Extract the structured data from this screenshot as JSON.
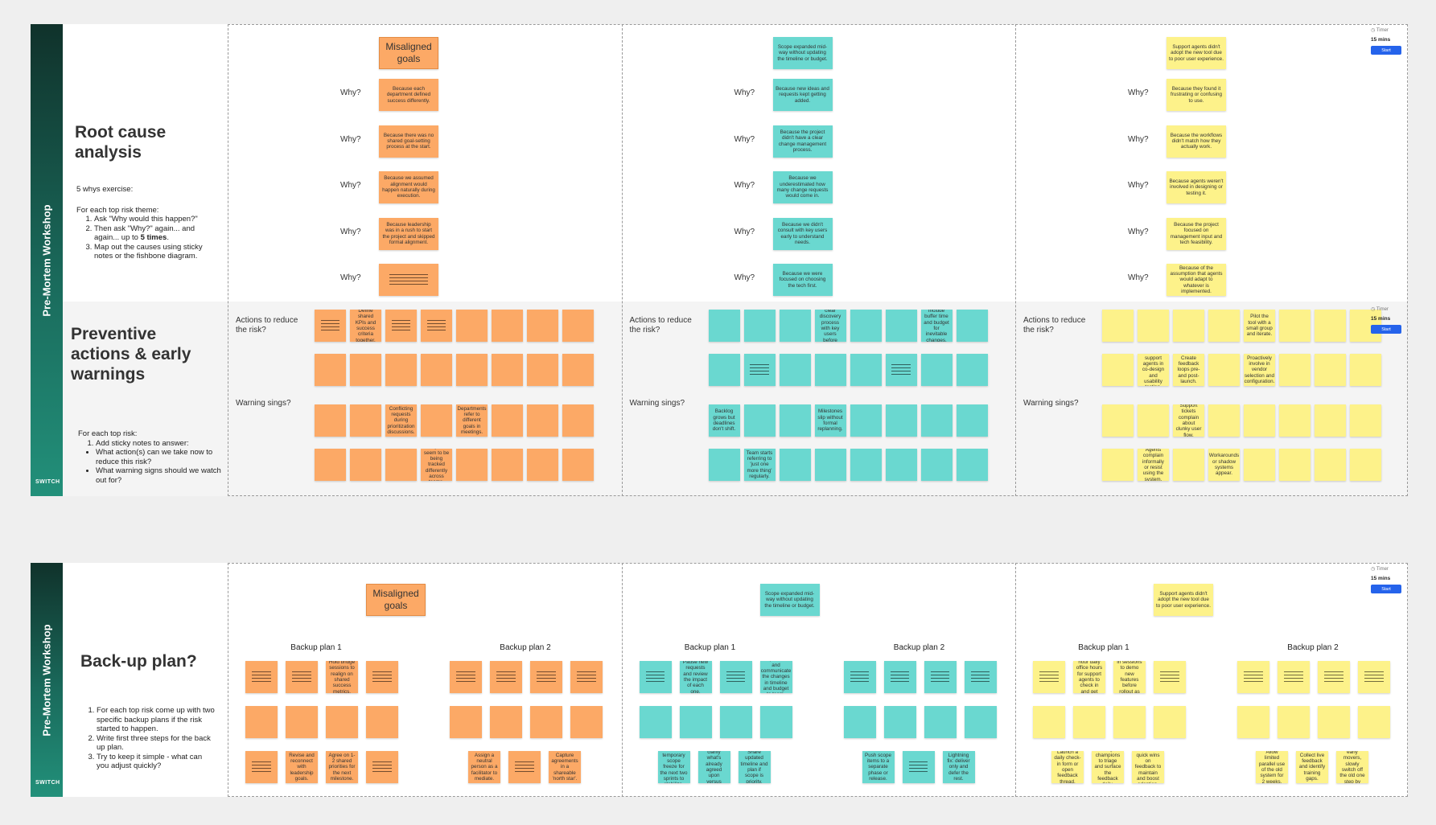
{
  "boards": [
    {
      "workshop_title": "Pre-Mortem Workshop",
      "logo": "SWITCH",
      "section1": {
        "title": "Root cause analysis",
        "exercise": "5 whys exercise:",
        "intro": "For each top risk theme:",
        "steps": [
          "Ask \"Why would this happen?\"",
          "Then ask \"Why?\" again... and again... up to 5 times.",
          "Map out the causes using sticky notes or the fishbone diagram."
        ]
      },
      "section2": {
        "title": "Preventive actions & early warnings",
        "intro": "For each top risk:",
        "step": "Add sticky notes to answer:",
        "bullets": [
          "What action(s) can we take now to reduce this risk?",
          "What warning signs should we watch out for?"
        ]
      },
      "why_label": "Why?",
      "actions_label": "Actions to reduce the risk?",
      "warning_label": "Warning sings?",
      "timer": {
        "label": "Timer",
        "time": "15 mins",
        "button": "Start"
      },
      "columns": [
        {
          "color": "orange",
          "top_note": "Misaligned goals",
          "whys": [
            "Because each department defined success differently.",
            "Because there was no shared goal-setting process at the start.",
            "Because we assumed alignment would happen naturally during execution.",
            "Because leadership was in a rush to start the project and skipped formal alignment.",
            ""
          ],
          "actions": [
            [
              "",
              "Define shared KPIs and success criteria together.",
              "",
              "",
              "",
              "",
              "",
              ""
            ],
            [
              "",
              "",
              "",
              "",
              "",
              "",
              "",
              ""
            ]
          ],
          "warnings": [
            [
              "",
              "",
              "Conflicting requests during prioritization discussions.",
              "",
              "Departments refer to different goals in meetings.",
              "",
              "",
              ""
            ],
            [
              "",
              "",
              "",
              "Projects seem to be being tracked differently across teams.",
              "",
              "",
              "",
              ""
            ]
          ]
        },
        {
          "color": "teal",
          "top_note": "Scope expanded mid-way without updating the timeline or budget.",
          "whys": [
            "Because new ideas and requests kept getting added.",
            "Because the project didn't have a clear change management process.",
            "Because we underestimated how many change requests would come in.",
            "Because we didn't consult with key users early to understand needs.",
            "Because we were focused on choosing the tech first."
          ],
          "actions": [
            [
              "",
              "",
              "",
              "Create a clear discovery process with key users before scoping.",
              "",
              "",
              "Include buffer time and budget for inevitable changes.",
              ""
            ],
            [
              "",
              "",
              "",
              "",
              "",
              "",
              "",
              ""
            ]
          ],
          "warnings": [
            [
              "Backlog grows but deadlines don't shift.",
              "",
              "",
              "Milestones slip without formal replanning.",
              "",
              "",
              "",
              ""
            ],
            [
              "",
              "Team starts referring to 'just one more thing' regularly.",
              "",
              "",
              "",
              "",
              "",
              ""
            ]
          ]
        },
        {
          "color": "yellow",
          "top_note": "Support agents didn't adopt the new tool due to poor user experience.",
          "whys": [
            "Because they found it frustrating or confusing to use.",
            "Because the workflows didn't match how they actually work.",
            "Because agents weren't involved in designing or testing it.",
            "Because the project focused on management input and tech feasibility.",
            "Because of the assumption that agents would adapt to whatever is implemented."
          ],
          "actions": [
            [
              "",
              "",
              "",
              "",
              "Pilot the tool with a small group and iterate.",
              "",
              "",
              ""
            ],
            [
              "",
              "Involve support agents in co-design and usability testing.",
              "Create feedback loops pre- and post-launch.",
              "",
              "Proactively involve in vendor selection and configuration.",
              "",
              "",
              ""
            ]
          ],
          "warnings": [
            [
              "",
              "",
              "Support tickets complain about clunky user flow.",
              "",
              "",
              "",
              "",
              ""
            ],
            [
              "",
              "Agents complain informally or resist using the system.",
              "",
              "Workarounds or shadow systems appear.",
              "",
              "",
              "",
              ""
            ]
          ]
        }
      ]
    },
    {
      "workshop_title": "Pre-Mortem Workshop",
      "logo": "SWITCH",
      "title": "Back-up plan?",
      "steps": [
        "For each top risk come up with two specific backup plans if the risk started to happen.",
        "Write first three steps for the back up plan.",
        "Try to keep it simple - what can you adjust quickly?"
      ],
      "timer": {
        "label": "Timer",
        "time": "15 mins",
        "button": "Start"
      },
      "plan1_label": "Backup plan 1",
      "plan2_label": "Backup plan 2",
      "columns": [
        {
          "color": "orange",
          "top_note": "Misaligned goals",
          "plan1": [
            [
              "",
              "",
              "Hold bridge sessions to realign on shared success metrics.",
              ""
            ],
            [
              "",
              "",
              "",
              ""
            ],
            [
              "",
              "Revise and reconnect with leadership goals.",
              "Agree on 1-2 shared priorities for the next milestone.",
              ""
            ]
          ],
          "plan2": [
            [
              "",
              "",
              "",
              ""
            ],
            [
              "",
              "",
              "",
              ""
            ],
            [
              "Assign a neutral person as a facilitator to mediate.",
              "",
              "Capture agreements in a shareable 'north star'."
            ]
          ]
        },
        {
          "color": "teal",
          "top_note": "Scope expanded mid-way without updating the timeline or budget.",
          "plan1": [
            [
              "",
              "Pause new requests and review the impact of each one.",
              "",
              "Reprioritise and communicate the changes in timeline and budget to team."
            ],
            [
              "",
              "",
              "",
              ""
            ],
            [
              "Introduce a temporary scope freeze for the next two sprints to stabilize.",
              "Review and clarify what's already agreed upon versus what's new.",
              "Share updated timeline and plan if scope is priority."
            ]
          ],
          "plan2": [
            [
              "",
              "",
              "",
              ""
            ],
            [
              "",
              "",
              "",
              ""
            ],
            [
              "Push scope items to a separate phase or release.",
              "",
              "Lightning fix: deliver only and defer the rest."
            ]
          ]
        },
        {
          "color": "yellow",
          "top_note": "Support agents didn't adopt the new tool due to poor user experience.",
          "plan1": [
            [
              "",
              "Run one-hour daily office hours for support agents to check in and get help.",
              "Hold drop-in sessions to demo new features before rollout as refresher.",
              ""
            ],
            [
              "",
              "",
              "",
              ""
            ],
            [
              "Launch a daily check-in form or open feedback thread.",
              "Assign champions to triage and surface the feedback daily.",
              "Deliver quick wins on feedback to maintain and boost adoption."
            ]
          ],
          "plan2": [
            [
              "",
              "",
              "",
              ""
            ],
            [
              "",
              "",
              "",
              ""
            ],
            [
              "Allow limited parallel use of the old system for 2 weeks.",
              "Collect live feedback and identify training gaps.",
              "Transition early movers, slowly switch off the old one step by step."
            ]
          ]
        }
      ]
    }
  ]
}
